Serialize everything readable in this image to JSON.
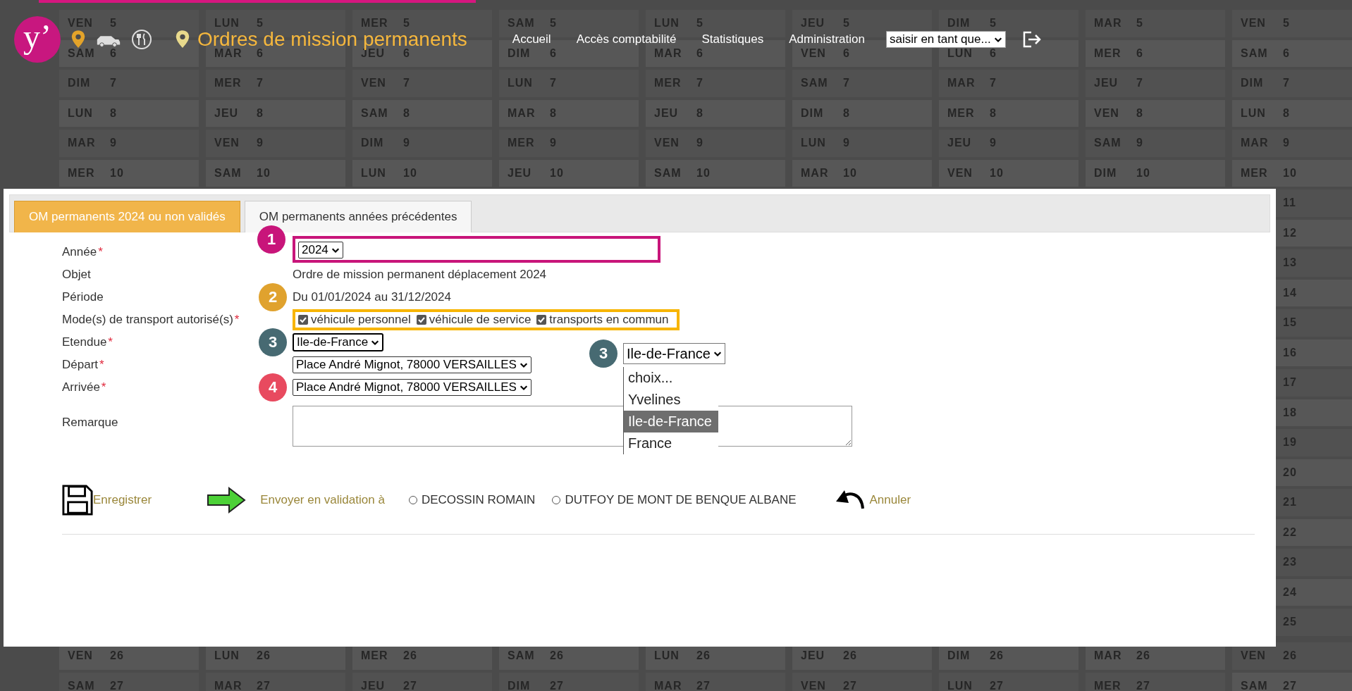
{
  "calendar": {
    "columns": [
      {
        "top": [
          {
            "day": "VEN",
            "date": "5"
          },
          {
            "day": "SAM",
            "date": "6"
          },
          {
            "day": "DIM",
            "date": "7"
          },
          {
            "day": "LUN",
            "date": "8"
          },
          {
            "day": "MAR",
            "date": "9"
          },
          {
            "day": "MER",
            "date": "10"
          }
        ],
        "bottom": [
          {
            "day": "VEN",
            "date": "26"
          },
          {
            "day": "SAM",
            "date": "27"
          }
        ]
      },
      {
        "top": [
          {
            "day": "LUN",
            "date": "5"
          },
          {
            "day": "MAR",
            "date": "6"
          },
          {
            "day": "MER",
            "date": "7"
          },
          {
            "day": "JEU",
            "date": "8"
          },
          {
            "day": "VEN",
            "date": "9"
          },
          {
            "day": "SAM",
            "date": "10"
          }
        ],
        "bottom": [
          {
            "day": "LUN",
            "date": "26"
          },
          {
            "day": "MAR",
            "date": "27"
          }
        ]
      },
      {
        "top": [
          {
            "day": "MER",
            "date": "5"
          },
          {
            "day": "JEU",
            "date": "6"
          },
          {
            "day": "VEN",
            "date": "7"
          },
          {
            "day": "SAM",
            "date": "8"
          },
          {
            "day": "DIM",
            "date": "9"
          },
          {
            "day": "LUN",
            "date": "10"
          }
        ],
        "bottom": [
          {
            "day": "MER",
            "date": "26"
          },
          {
            "day": "JEU",
            "date": "27"
          }
        ]
      },
      {
        "top": [
          {
            "day": "SAM",
            "date": "5"
          },
          {
            "day": "DIM",
            "date": "6"
          },
          {
            "day": "LUN",
            "date": "7"
          },
          {
            "day": "MAR",
            "date": "8"
          },
          {
            "day": "MER",
            "date": "9"
          },
          {
            "day": "JEU",
            "date": "10"
          }
        ],
        "bottom": [
          {
            "day": "SAM",
            "date": "26"
          },
          {
            "day": "DIM",
            "date": "27"
          }
        ]
      },
      {
        "top": [
          {
            "day": "LUN",
            "date": "5"
          },
          {
            "day": "MAR",
            "date": "6"
          },
          {
            "day": "MER",
            "date": "7"
          },
          {
            "day": "JEU",
            "date": "8"
          },
          {
            "day": "VEN",
            "date": "9"
          },
          {
            "day": "SAM",
            "date": "10"
          }
        ],
        "bottom": [
          {
            "day": "LUN",
            "date": "26"
          },
          {
            "day": "MAR",
            "date": "27"
          }
        ]
      },
      {
        "top": [
          {
            "day": "JEU",
            "date": "5"
          },
          {
            "day": "VEN",
            "date": "6"
          },
          {
            "day": "SAM",
            "date": "7"
          },
          {
            "day": "DIM",
            "date": "8"
          },
          {
            "day": "LUN",
            "date": "9"
          },
          {
            "day": "MAR",
            "date": "10"
          }
        ],
        "bottom": [
          {
            "day": "JEU",
            "date": "26"
          },
          {
            "day": "VEN",
            "date": "27"
          }
        ]
      },
      {
        "top": [
          {
            "day": "DIM",
            "date": "5"
          },
          {
            "day": "LUN",
            "date": "6"
          },
          {
            "day": "MAR",
            "date": "7"
          },
          {
            "day": "MER",
            "date": "8"
          },
          {
            "day": "JEU",
            "date": "9"
          },
          {
            "day": "VEN",
            "date": "10"
          }
        ],
        "bottom": [
          {
            "day": "DIM",
            "date": "26"
          },
          {
            "day": "LUN",
            "date": "27"
          }
        ]
      },
      {
        "top": [
          {
            "day": "MAR",
            "date": "5"
          },
          {
            "day": "MER",
            "date": "6"
          },
          {
            "day": "JEU",
            "date": "7"
          },
          {
            "day": "VEN",
            "date": "8"
          },
          {
            "day": "SAM",
            "date": "9"
          },
          {
            "day": "DIM",
            "date": "10"
          }
        ],
        "bottom": [
          {
            "day": "MAR",
            "date": "26"
          },
          {
            "day": "MER",
            "date": "27"
          }
        ]
      },
      {
        "top": [
          {
            "day": "VEN",
            "date": "5"
          },
          {
            "day": "SAM",
            "date": "6"
          },
          {
            "day": "DIM",
            "date": "7"
          },
          {
            "day": "LUN",
            "date": "8"
          },
          {
            "day": "MAR",
            "date": "9"
          },
          {
            "day": "MER",
            "date": "10"
          }
        ],
        "middle": [
          {
            "date": "11"
          },
          {
            "date": "12"
          },
          {
            "date": "13"
          },
          {
            "date": "14"
          },
          {
            "date": "15"
          },
          {
            "date": "16"
          },
          {
            "date": "17"
          },
          {
            "date": "18"
          },
          {
            "date": "19"
          },
          {
            "date": "20"
          },
          {
            "date": "21"
          },
          {
            "date": "22"
          },
          {
            "date": "23"
          },
          {
            "date": "24"
          },
          {
            "date": "25"
          }
        ],
        "bottom": [
          {
            "day": "VEN",
            "date": "26"
          },
          {
            "day": "SAM",
            "date": "27"
          }
        ]
      }
    ]
  },
  "header": {
    "logo": "y’",
    "title": "Ordres de mission permanents",
    "nav": [
      {
        "label": "Accueil"
      },
      {
        "label": "Accès comptabilité"
      },
      {
        "label": "Statistiques"
      },
      {
        "label": "Administration"
      }
    ],
    "user_select": {
      "value": "saisir en tant que..."
    }
  },
  "tabs": [
    {
      "label": "OM permanents 2024 ou non validés",
      "selected": true
    },
    {
      "label": "OM permanents années précédentes",
      "selected": false
    }
  ],
  "form": {
    "required_mark": "*",
    "fields": [
      {
        "kind": "select",
        "label": "Année",
        "required": true,
        "value": "2024",
        "callout": {
          "number": "1",
          "color": "#c8157a"
        },
        "highlight": {
          "color": "#c8157a"
        }
      },
      {
        "kind": "text",
        "label": "Objet",
        "required": false,
        "value": "Ordre de mission permanent déplacement 2024"
      },
      {
        "kind": "text",
        "label": "Période",
        "required": false,
        "value": "Du 01/01/2024 au 31/12/2024",
        "callout": {
          "number": "2",
          "color": "#e0a22e"
        }
      },
      {
        "kind": "checkboxes",
        "label": "Mode(s) de transport autorisé(s)",
        "required": true,
        "highlight": {
          "color": "#f7b500"
        },
        "options": [
          {
            "label": "véhicule personnel",
            "checked": true
          },
          {
            "label": "véhicule de service",
            "checked": true
          },
          {
            "label": "transports en commun",
            "checked": true
          }
        ]
      },
      {
        "kind": "select",
        "label": "Etendue",
        "required": true,
        "value": "Ile-de-France",
        "callout": {
          "number": "3",
          "color": "#476a72"
        }
      },
      {
        "kind": "select",
        "label": "Départ",
        "required": true,
        "value": "Place André Mignot, 78000 VERSAILLES"
      },
      {
        "kind": "select",
        "label": "Arrivée",
        "required": true,
        "value": "Place André Mignot, 78000 VERSAILLES",
        "callout": {
          "number": "4",
          "color": "#e84a5f"
        }
      },
      {
        "kind": "textarea",
        "label": "Remarque",
        "required": false
      }
    ]
  },
  "dropdown_inset": {
    "callout": {
      "number": "3",
      "color": "#476a72"
    },
    "value": "Ile-de-France",
    "options": [
      {
        "label": "choix...",
        "selected": false
      },
      {
        "label": "Yvelines",
        "selected": false
      },
      {
        "label": "Ile-de-France",
        "selected": true
      },
      {
        "label": "France",
        "selected": false
      }
    ]
  },
  "actions": {
    "save": "Enregistrer",
    "send": "Envoyer en validation à",
    "validators": [
      {
        "label": "DECOSSIN ROMAIN",
        "selected": false
      },
      {
        "label": "DUTFOY DE MONT DE BENQUE ALBANE",
        "selected": false
      }
    ],
    "cancel": "Annuler"
  }
}
